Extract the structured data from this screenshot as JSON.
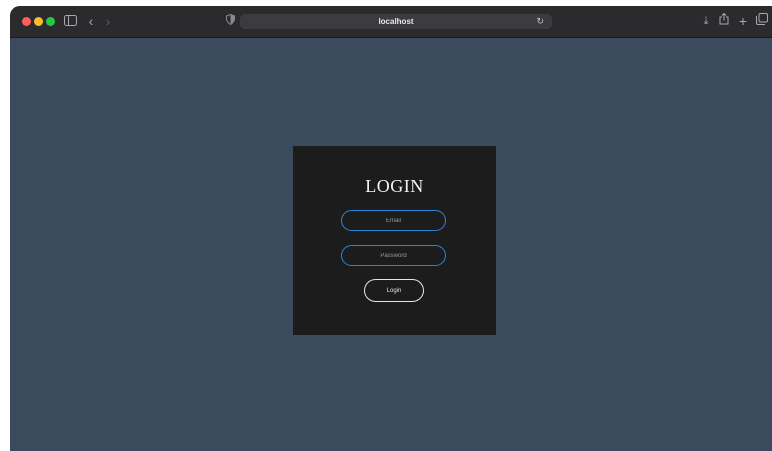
{
  "browser": {
    "url": "localhost",
    "icons": {
      "sidebar": "sidebar-icon",
      "back": "chevron-left-icon",
      "forward": "chevron-right-icon",
      "privacy": "shield-icon",
      "reload": "reload-icon",
      "download": "download-icon",
      "share": "share-icon",
      "new_tab": "plus-icon",
      "tabs": "tabs-overview-icon"
    }
  },
  "login": {
    "title": "LOGIN",
    "email_placeholder": "Email",
    "password_placeholder": "Password",
    "button_label": "Login"
  },
  "colors": {
    "page_background": "#3b4a5c",
    "card_background": "#1c1c1c",
    "input_border": "#2f83d6",
    "button_border": "#e6e6e6"
  }
}
